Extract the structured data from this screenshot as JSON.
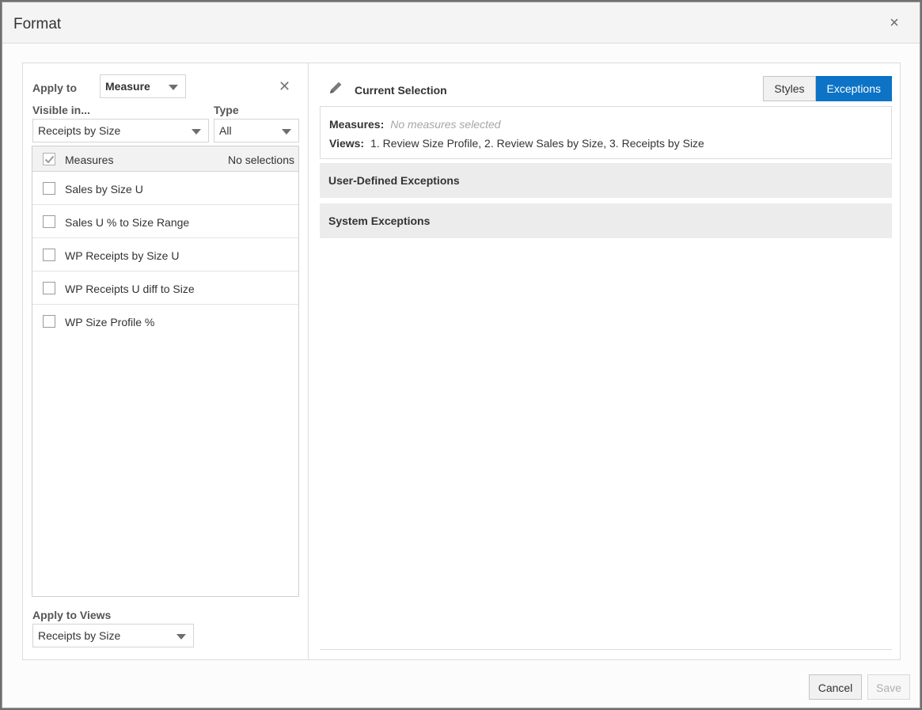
{
  "dialog": {
    "title": "Format",
    "close_glyph": "×"
  },
  "left": {
    "apply_to_label": "Apply to",
    "apply_to_value": "Measure",
    "clear_glyph": "✕",
    "visible_in_label": "Visible in...",
    "visible_in_value": "Receipts by Size",
    "type_label": "Type",
    "type_value": "All",
    "list": {
      "header_label": "Measures",
      "header_status": "No selections",
      "items": [
        {
          "label": "Sales by Size U"
        },
        {
          "label": "Sales U % to Size Range"
        },
        {
          "label": "WP Receipts by Size U"
        },
        {
          "label": "WP Receipts U diff to Size"
        },
        {
          "label": "WP Size Profile %"
        }
      ]
    },
    "apply_views_label": "Apply to Views",
    "apply_views_value": "Receipts by Size"
  },
  "right": {
    "current_selection_label": "Current Selection",
    "tabs": {
      "styles": "Styles",
      "exceptions": "Exceptions",
      "active": "exceptions"
    },
    "measures_label": "Measures:",
    "measures_value": "No measures selected",
    "views_label": "Views:",
    "views_value": "1. Review Size Profile, 2. Review Sales by Size, 3. Receipts by Size",
    "sections": [
      {
        "label": "User-Defined Exceptions"
      },
      {
        "label": "System Exceptions"
      }
    ]
  },
  "footer": {
    "cancel": "Cancel",
    "save": "Save"
  },
  "colors": {
    "accent": "#0c73c6",
    "section_bg": "#ececec",
    "muted_text": "#a6a6a6"
  },
  "icons": {
    "close": "close-icon",
    "clear": "clear-x-icon",
    "caret": "caret-down-icon",
    "check": "checkmark-icon",
    "pencil": "pencil-icon"
  }
}
